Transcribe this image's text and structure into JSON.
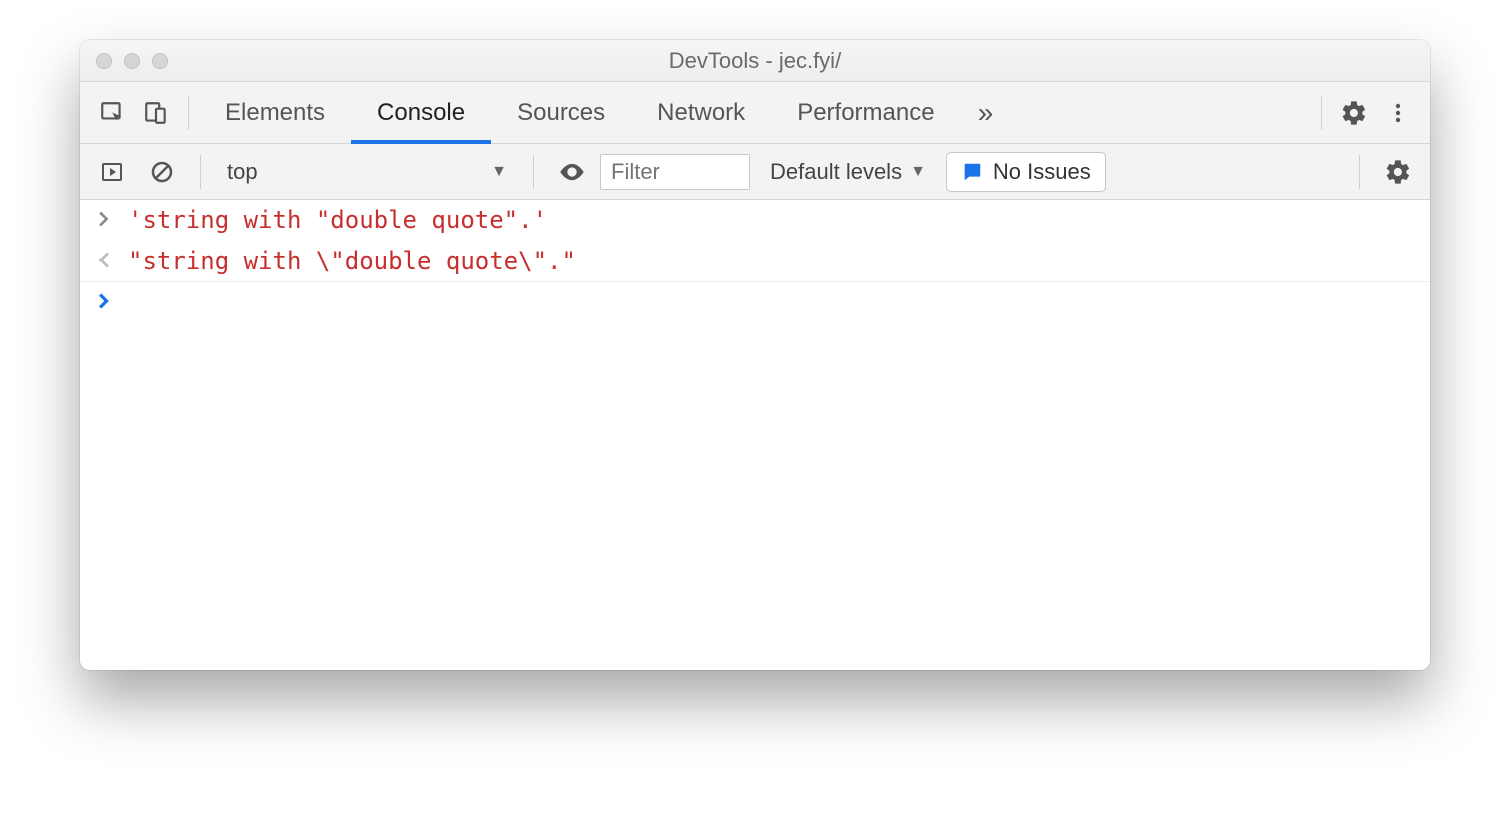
{
  "window": {
    "title": "DevTools - jec.fyi/"
  },
  "tabs": {
    "items": [
      "Elements",
      "Console",
      "Sources",
      "Network",
      "Performance"
    ],
    "active": "Console",
    "more_glyph": "»"
  },
  "toolbar": {
    "context": "top",
    "filter_placeholder": "Filter",
    "levels_label": "Default levels",
    "issues_label": "No Issues"
  },
  "console": {
    "input_line": "'string with \"double quote\".'",
    "output_line": "\"string with \\\"double quote\\\".\""
  }
}
